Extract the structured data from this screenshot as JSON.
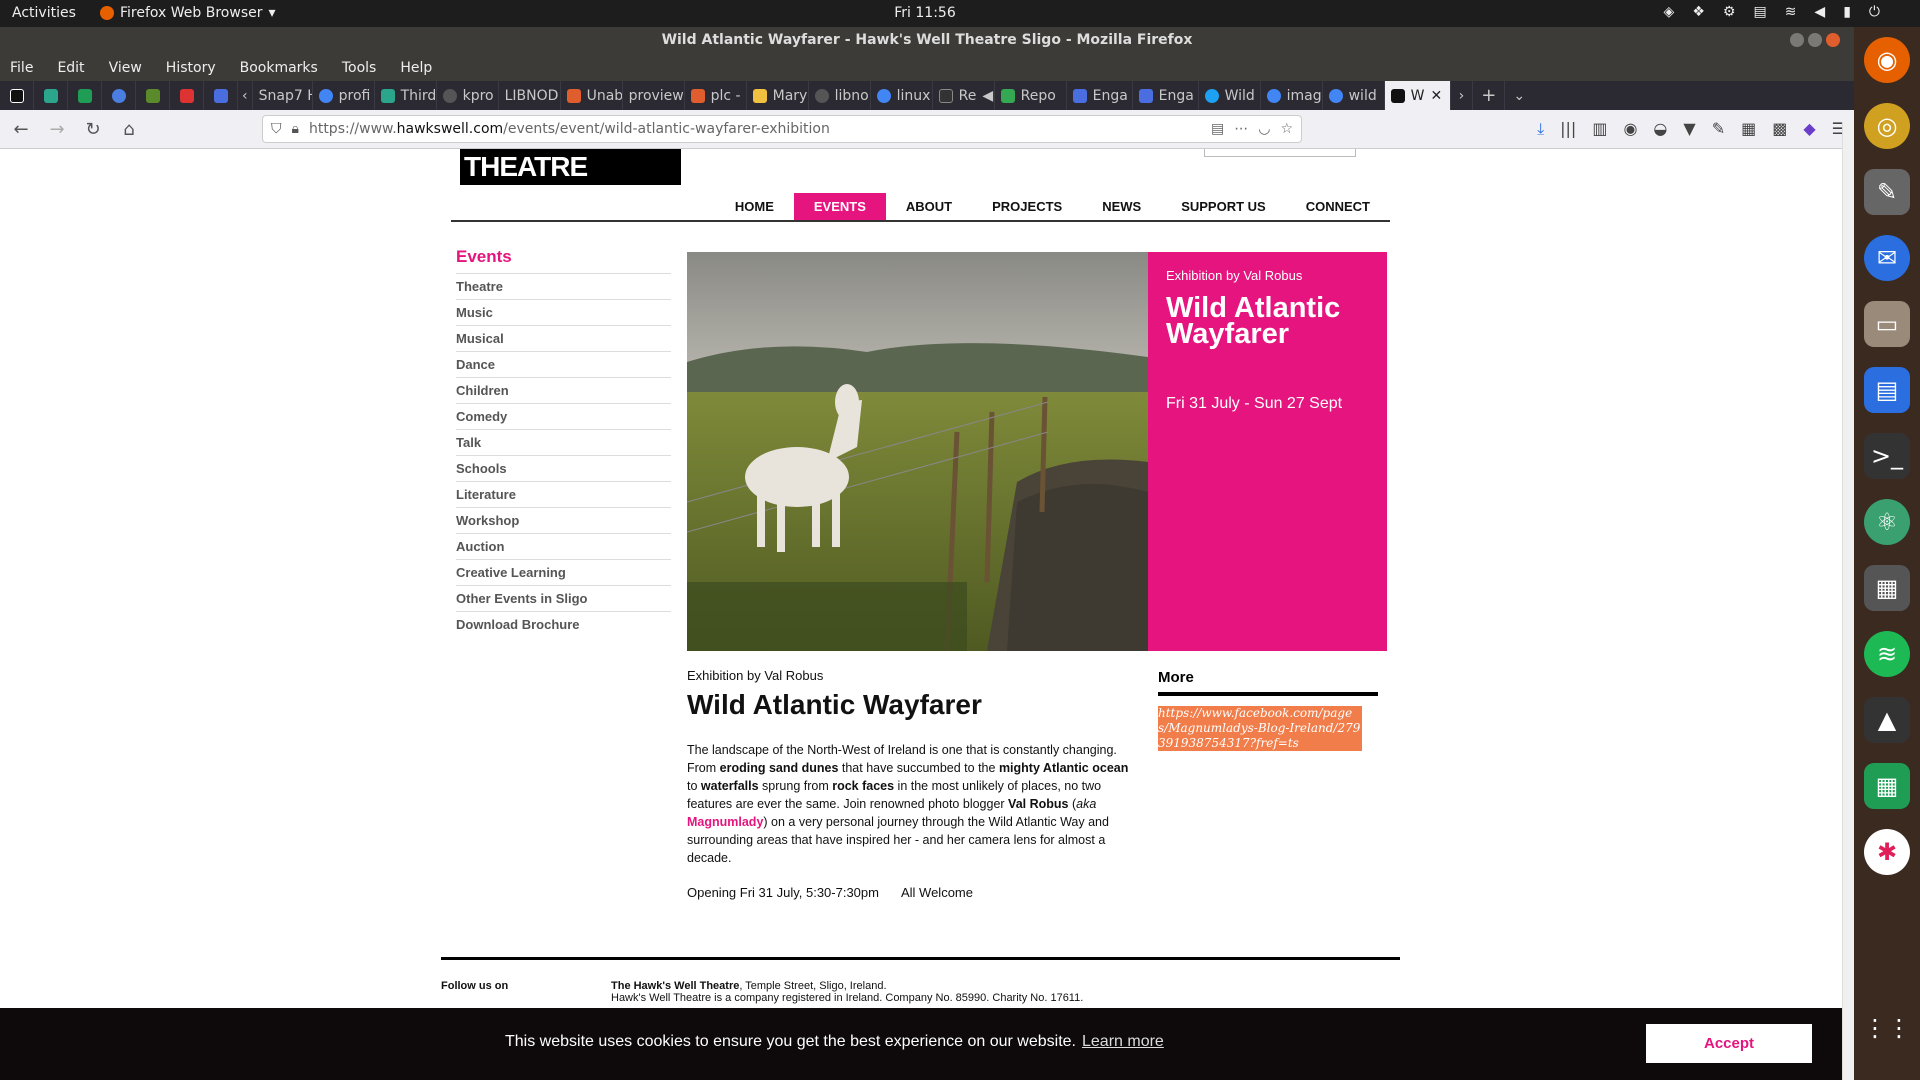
{
  "topbar": {
    "activities": "Activities",
    "app": "Firefox Web Browser",
    "clock": "Fri 11:56"
  },
  "window": {
    "title": "Wild Atlantic Wayfarer - Hawk's Well Theatre Sligo - Mozilla Firefox"
  },
  "menu": [
    "File",
    "Edit",
    "View",
    "History",
    "Bookmarks",
    "Tools",
    "Help"
  ],
  "tabs": [
    {
      "label": "Snap7 H",
      "color": "#777"
    },
    {
      "label": "profi",
      "color": "#4285f4"
    },
    {
      "label": "Third",
      "color": "#2ba58c"
    },
    {
      "label": "kpro",
      "color": "#555"
    },
    {
      "label": "LIBNOD",
      "color": "#888"
    },
    {
      "label": "Unab",
      "color": "#e05d2d"
    },
    {
      "label": "proview",
      "color": "#888"
    },
    {
      "label": "plc -",
      "color": "#e05d2d"
    },
    {
      "label": "Mary",
      "color": "#f0c040"
    },
    {
      "label": "libno",
      "color": "#555"
    },
    {
      "label": "linux",
      "color": "#4285f4"
    },
    {
      "label": "Re",
      "color": "#333"
    },
    {
      "label": "Repo",
      "color": "#34a853"
    },
    {
      "label": "Enga",
      "color": "#4a6ee0"
    },
    {
      "label": "Enga",
      "color": "#4a6ee0"
    },
    {
      "label": "Wild",
      "color": "#1da1f2"
    },
    {
      "label": "imag",
      "color": "#4285f4"
    },
    {
      "label": "wild",
      "color": "#4285f4"
    },
    {
      "label": "W",
      "color": "#111"
    }
  ],
  "url": {
    "pre": "https://www.",
    "domain": "hawkswell.com",
    "path": "/events/event/wild-atlantic-wayfarer-exhibition"
  },
  "site": {
    "logo": "THEATRE",
    "nav": [
      "HOME",
      "EVENTS",
      "ABOUT",
      "PROJECTS",
      "NEWS",
      "SUPPORT US",
      "CONNECT"
    ],
    "sidebar_title": "Events",
    "sidebar": [
      "Theatre",
      "Music",
      "Musical",
      "Dance",
      "Children",
      "Comedy",
      "Talk",
      "Schools",
      "Literature",
      "Workshop",
      "Auction",
      "Creative Learning",
      "Other Events in Sligo",
      "Download Brochure"
    ],
    "hero": {
      "by": "Exhibition by Val Robus",
      "title": "Wild Atlantic Wayfarer",
      "dates": "Fri 31 July - Sun 27 Sept"
    },
    "event": {
      "by": "Exhibition by Val Robus",
      "title": "Wild Atlantic Wayfarer",
      "p1": "The landscape of the North-West of Ireland is one that is constantly changing. From ",
      "b1": "eroding sand dunes",
      "p2": " that have succumbed to the ",
      "b2": "mighty Atlantic ocean",
      "p3": " to ",
      "b3": "waterfalls",
      "p4": " sprung from ",
      "b4": "rock faces",
      "p5": " in the most unlikely of places, no two features are ever the same. Join renowned photo blogger ",
      "b5": "Val Robus",
      "p6": " (",
      "i1": "aka",
      "pink": "Magnumlady",
      "p7": ") on a very personal journey through the Wild Atlantic Way and surrounding areas that have inspired her - and her camera lens for almost a decade.",
      "opening": "Opening Fri 31 July, 5:30-7:30pm",
      "welcome": "All Welcome"
    },
    "more": {
      "heading": "More",
      "link": "https://www.facebook.com/pages/Magnumladys-Blog-Ireland/279391938754317?fref=ts"
    },
    "footer": {
      "follow": "Follow us on",
      "name": "The Hawk's Well Theatre",
      "addr": ", Temple Street, Sligo, Ireland.",
      "reg": "Hawk's Well Theatre is a company registered in Ireland. Company No. 85990. Charity No. 17611."
    },
    "cookie": {
      "msg": "This website uses cookies to ensure you get the best experience on our website.",
      "learn": "Learn more",
      "accept": "Accept"
    }
  }
}
